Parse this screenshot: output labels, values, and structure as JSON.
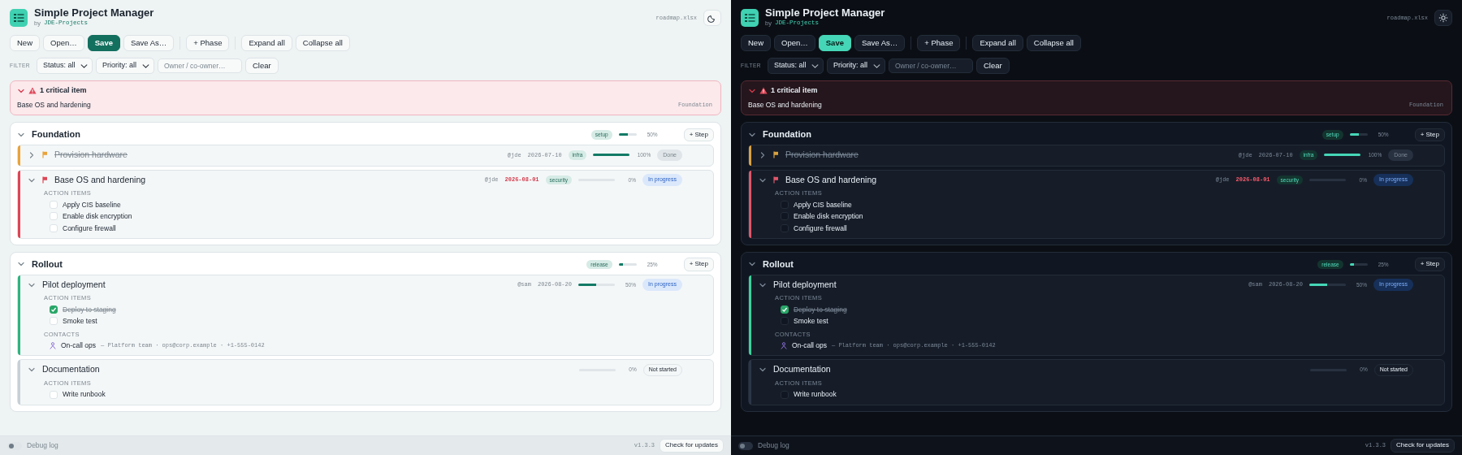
{
  "panes": [
    {
      "kind": "light",
      "app": {
        "title": "Simple Project Manager",
        "byline": "by",
        "author": "JDE-Projects",
        "file_name": "roadmap.xlsx"
      },
      "toolbar": [
        [
          {
            "label": "New",
            "kind": "plain"
          },
          {
            "label": "Open…",
            "kind": "plain"
          },
          {
            "label": "Save",
            "kind": "primary"
          },
          {
            "label": "Save As…",
            "kind": "plain"
          }
        ],
        [
          {
            "label": "+ Phase",
            "kind": "plain"
          }
        ],
        [
          {
            "label": "Expand all",
            "kind": "plain"
          },
          {
            "label": "Collapse all",
            "kind": "plain"
          }
        ]
      ],
      "filter": {
        "label": "FILTER",
        "status": "Status: all",
        "priority": "Priority: all",
        "owner_placeholder": "Owner / co-owner…",
        "clear": "Clear"
      },
      "critical": {
        "expanded": true,
        "title": "1 critical item",
        "items": [
          {
            "name": "Base OS and hardening",
            "phase": "Foundation"
          }
        ]
      },
      "phases": [
        {
          "name": "Foundation",
          "expanded": true,
          "tag": "setup",
          "level": 0.5,
          "percent": "50%",
          "add_step": "+ Step",
          "steps": [
            {
              "name": "Provision hardware",
              "expanded": false,
              "flagged": true,
              "color": "#e9a23b",
              "done": true,
              "owner": "@jde",
              "due": "2026-07-10",
              "overdue": false,
              "tag": "infra",
              "level": 1,
              "percent": "100%",
              "status": "Done",
              "kind": "done"
            },
            {
              "name": "Base OS and hardening",
              "expanded": true,
              "flagged": true,
              "color": "#dc4655",
              "done": false,
              "owner": "@jde",
              "due": "2026-08-01",
              "overdue": true,
              "tag": "security",
              "level": 0,
              "percent": "0%",
              "status": "In progress",
              "kind": "in_progress",
              "action_items_label": "ACTION ITEMS",
              "action_items": [
                {
                  "text": "Apply CIS baseline",
                  "checked": false
                },
                {
                  "text": "Enable disk encryption",
                  "checked": false
                },
                {
                  "text": "Configure firewall",
                  "checked": false
                }
              ]
            }
          ]
        },
        {
          "name": "Rollout",
          "expanded": true,
          "tag": "release",
          "level": 0.25,
          "percent": "25%",
          "add_step": "+ Step",
          "steps": [
            {
              "name": "Pilot deployment",
              "expanded": true,
              "flagged": false,
              "color": "#2fb37f",
              "done": false,
              "owner": "@sam",
              "due": "2026-08-20",
              "overdue": false,
              "level": 0.5,
              "percent": "50%",
              "status": "In progress",
              "kind": "in_progress",
              "action_items_label": "ACTION ITEMS",
              "action_items": [
                {
                  "text": "Deploy to staging",
                  "checked": true
                },
                {
                  "text": "Smoke test",
                  "checked": false
                }
              ],
              "contacts_label": "CONTACTS",
              "contacts": [
                {
                  "name": "On-call ops",
                  "details": "— Platform team · ops@corp.example · +1-555-0142"
                }
              ]
            },
            {
              "name": "Documentation",
              "expanded": true,
              "flagged": false,
              "color": "#c6d0d6",
              "done": false,
              "level": 0,
              "percent": "0%",
              "status": "Not started",
              "kind": "not_started",
              "action_items_label": "ACTION ITEMS",
              "action_items": [
                {
                  "text": "Write runbook",
                  "checked": false
                }
              ]
            }
          ]
        }
      ],
      "footer": {
        "debug_label": "Debug log",
        "debug_on": false,
        "version": "v1.3.3",
        "update_button": "Check for updates"
      }
    },
    {
      "kind": "dark",
      "app": {
        "title": "Simple Project Manager",
        "byline": "by",
        "author": "JDE-Projects",
        "file_name": "roadmap.xlsx"
      },
      "toolbar": [
        [
          {
            "label": "New",
            "kind": "plain"
          },
          {
            "label": "Open…",
            "kind": "plain"
          },
          {
            "label": "Save",
            "kind": "primary"
          },
          {
            "label": "Save As…",
            "kind": "plain"
          }
        ],
        [
          {
            "label": "+ Phase",
            "kind": "plain"
          }
        ],
        [
          {
            "label": "Expand all",
            "kind": "plain"
          },
          {
            "label": "Collapse all",
            "kind": "plain"
          }
        ]
      ],
      "filter": {
        "label": "FILTER",
        "status": "Status: all",
        "priority": "Priority: all",
        "owner_placeholder": "Owner / co-owner…",
        "clear": "Clear"
      },
      "critical": {
        "expanded": true,
        "title": "1 critical item",
        "items": [
          {
            "name": "Base OS and hardening",
            "phase": "Foundation"
          }
        ]
      },
      "phases": [
        {
          "name": "Foundation",
          "expanded": true,
          "tag": "setup",
          "level": 0.5,
          "percent": "50%",
          "add_step": "+ Step",
          "steps": [
            {
              "name": "Provision hardware",
              "expanded": false,
              "flagged": true,
              "color": "#d9a13f",
              "done": true,
              "owner": "@jde",
              "due": "2026-07-10",
              "overdue": false,
              "tag": "infra",
              "level": 1,
              "percent": "100%",
              "status": "Done",
              "kind": "done"
            },
            {
              "name": "Base OS and hardening",
              "expanded": true,
              "flagged": true,
              "color": "#e0566a",
              "done": false,
              "owner": "@jde",
              "due": "2026-08-01",
              "overdue": true,
              "tag": "security",
              "level": 0,
              "percent": "0%",
              "status": "In progress",
              "kind": "in_progress",
              "action_items_label": "ACTION ITEMS",
              "action_items": [
                {
                  "text": "Apply CIS baseline",
                  "checked": false
                },
                {
                  "text": "Enable disk encryption",
                  "checked": false
                },
                {
                  "text": "Configure firewall",
                  "checked": false
                }
              ]
            }
          ]
        },
        {
          "name": "Rollout",
          "expanded": true,
          "tag": "release",
          "level": 0.25,
          "percent": "25%",
          "add_step": "+ Step",
          "steps": [
            {
              "name": "Pilot deployment",
              "expanded": true,
              "flagged": false,
              "color": "#38d39a",
              "done": false,
              "owner": "@sam",
              "due": "2026-08-20",
              "overdue": false,
              "level": 0.5,
              "percent": "50%",
              "status": "In progress",
              "kind": "in_progress",
              "action_items_label": "ACTION ITEMS",
              "action_items": [
                {
                  "text": "Deploy to staging",
                  "checked": true
                },
                {
                  "text": "Smoke test",
                  "checked": false
                }
              ],
              "contacts_label": "CONTACTS",
              "contacts": [
                {
                  "name": "On-call ops",
                  "details": "— Platform team · ops@corp.example · +1-555-0142"
                }
              ]
            },
            {
              "name": "Documentation",
              "expanded": true,
              "flagged": false,
              "color": "#2c3648",
              "done": false,
              "level": 0,
              "percent": "0%",
              "status": "Not started",
              "kind": "not_started",
              "action_items_label": "ACTION ITEMS",
              "action_items": [
                {
                  "text": "Write runbook",
                  "checked": false
                }
              ]
            }
          ]
        }
      ],
      "footer": {
        "debug_label": "Debug log",
        "debug_on": false,
        "version": "v1.3.3",
        "update_button": "Check for updates"
      }
    }
  ]
}
